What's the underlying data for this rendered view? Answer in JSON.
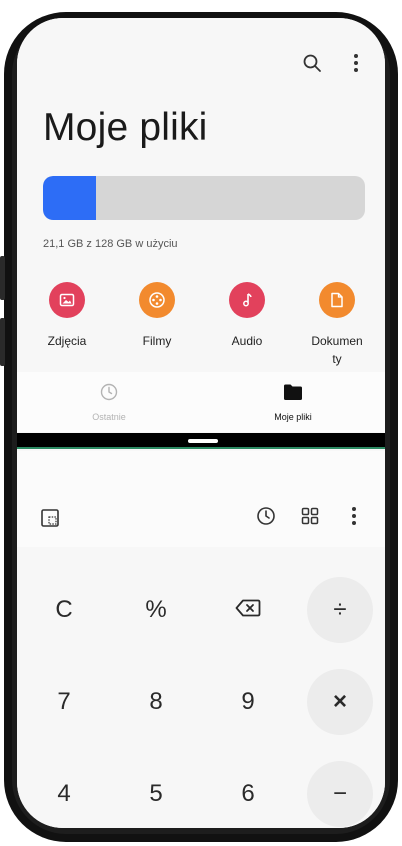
{
  "files_app": {
    "title": "Moje pliki",
    "storage_text": "21,1 GB z 128 GB w użyciu",
    "storage_used_fraction": 0.165,
    "categories": [
      {
        "label": "Zdjęcia",
        "icon": "image-icon",
        "color": "#e2415c"
      },
      {
        "label": "Filmy",
        "icon": "film-reel-icon",
        "color": "#f28a2e"
      },
      {
        "label": "Audio",
        "icon": "music-note-icon",
        "color": "#e2415c"
      },
      {
        "label": "Dokumenty",
        "icon": "document-icon",
        "color": "#f28a2e"
      }
    ],
    "nav": {
      "recent": "Ostatnie",
      "my_files": "Moje pliki"
    },
    "accent": "#2d6df6"
  },
  "calculator": {
    "keys_row1": [
      "C",
      "%",
      "⌫",
      "÷"
    ],
    "keys_row2": [
      "7",
      "8",
      "9",
      "×"
    ],
    "keys_row3": [
      "4",
      "5",
      "6",
      "−"
    ]
  }
}
